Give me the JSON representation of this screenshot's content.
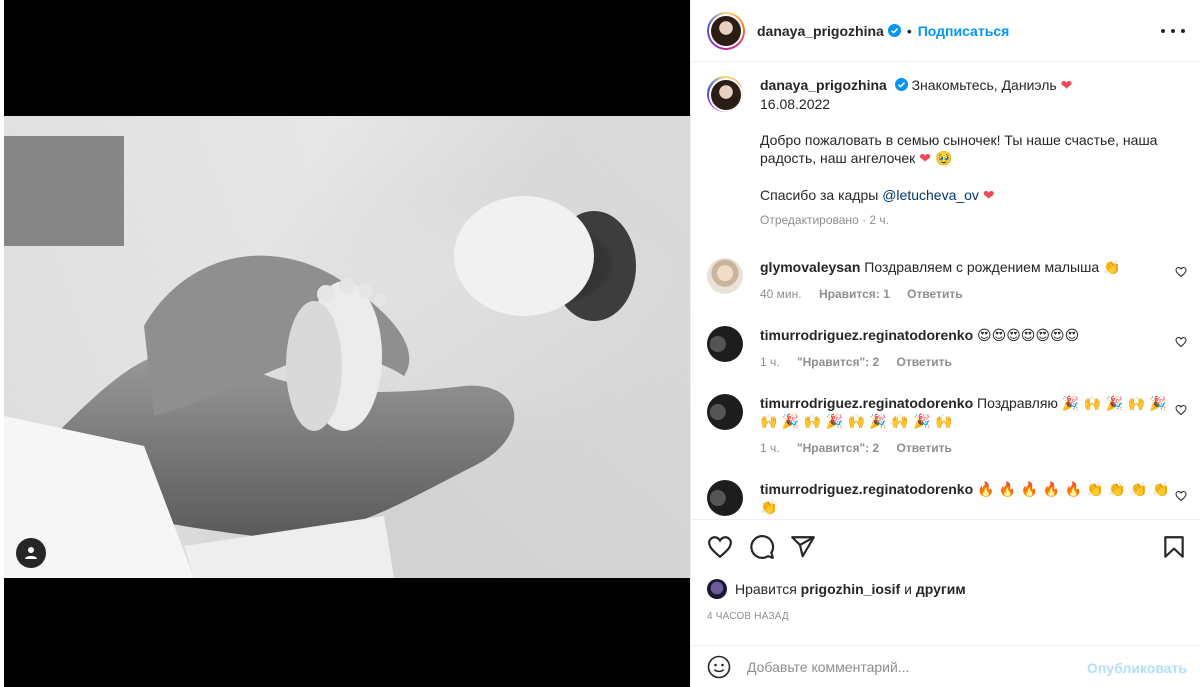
{
  "header": {
    "username": "danaya_prigozhina",
    "separator": "•",
    "follow_label": "Подписаться"
  },
  "caption": {
    "username": "danaya_prigozhina",
    "title": "Знакомьтесь, Даниэль",
    "title_emoji": "❤",
    "date": "16.08.2022",
    "body_line1": "Добро пожаловать в семью сыночек! Ты наше счастье, наша",
    "body_line2": "радость, наш ангелочек",
    "body_emojis": "❤ 🥹",
    "thanks_prefix": "Спасибо за кадры",
    "mention": "@letucheva_ov",
    "thanks_emoji": "❤",
    "edited_meta": "Отредактировано · 2 ч."
  },
  "comments": [
    {
      "user": "glymovaleysan",
      "text": "Поздравляем с рождением малыша",
      "emojis": "👏",
      "time": "40 мин.",
      "likes": "Нравится: 1",
      "reply": "Ответить"
    },
    {
      "user": "timurrodriguez.reginatodorenko",
      "text": "",
      "emojis": "😍😍😍😍😍😍😍",
      "time": "1 ч.",
      "likes": "\"Нравится\": 2",
      "reply": "Ответить"
    },
    {
      "user": "timurrodriguez.reginatodorenko",
      "text": "Поздравляю",
      "emojis": "🎉 🙌 🎉 🙌 🎉",
      "emojis_line2": "🙌 🎉 🙌 🎉 🙌 🎉 🙌 🎉 🙌",
      "time": "1 ч.",
      "likes": "\"Нравится\": 2",
      "reply": "Ответить"
    },
    {
      "user": "timurrodriguez.reginatodorenko",
      "text": "",
      "emojis": "🔥 🔥 🔥 🔥 🔥 👏 👏 👏 👏",
      "emojis_line2": "👏"
    }
  ],
  "likes": {
    "prefix": "Нравится",
    "user": "prigozhin_iosif",
    "conj": "и",
    "others": "другим"
  },
  "time_ago": "4 часов назад",
  "add_comment": {
    "placeholder": "Добавьте комментарий...",
    "post_label": "Опубликовать"
  },
  "colors": {
    "accent": "#0095f6",
    "like_red": "#ed4956",
    "post_disabled": "#b2dffc",
    "secondary_text": "#8e8e8e"
  },
  "icons": [
    "more-icon",
    "verified-icon",
    "heart-icon",
    "comment-icon",
    "share-icon",
    "bookmark-icon",
    "smiley-icon",
    "user-tag-icon",
    "comment-heart-icon"
  ]
}
